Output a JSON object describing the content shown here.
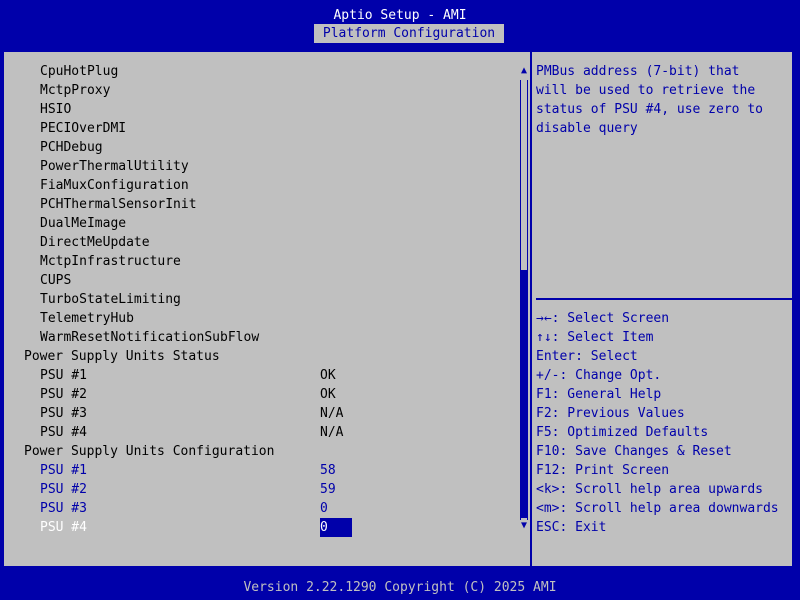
{
  "header": {
    "title": "Aptio Setup - AMI",
    "tab": "Platform Configuration"
  },
  "left": {
    "items": [
      "CpuHotPlug",
      "MctpProxy",
      "HSIO",
      "PECIOverDMI",
      "PCHDebug",
      "PowerThermalUtility",
      "FiaMuxConfiguration",
      "PCHThermalSensorInit",
      "DualMeImage",
      "DirectMeUpdate",
      "MctpInfrastructure",
      "CUPS",
      "TurboStateLimiting",
      "TelemetryHub",
      "WarmResetNotificationSubFlow"
    ],
    "status_heading": "Power Supply Units Status",
    "status_rows": [
      {
        "label": "PSU #1",
        "value": "OK"
      },
      {
        "label": "PSU #2",
        "value": "OK"
      },
      {
        "label": "PSU #3",
        "value": "N/A"
      },
      {
        "label": "PSU #4",
        "value": "N/A"
      }
    ],
    "config_heading": "Power Supply Units Configuration",
    "config_rows": [
      {
        "label": "PSU #1",
        "value": "58"
      },
      {
        "label": "PSU #2",
        "value": "59"
      },
      {
        "label": "PSU #3",
        "value": "0"
      },
      {
        "label": "PSU #4",
        "value": "0",
        "focused": true
      }
    ]
  },
  "help": {
    "description": [
      "PMBus address (7-bit) that",
      "will be used to retrieve the",
      "status of PSU #4, use zero to",
      "disable query"
    ],
    "keys": [
      "→←: Select Screen",
      "↑↓: Select Item",
      "Enter: Select",
      "+/-: Change Opt.",
      "F1: General Help",
      "F2: Previous Values",
      "F5: Optimized Defaults",
      "F10: Save Changes & Reset",
      "F12: Print Screen",
      "<k>: Scroll help area upwards",
      "<m>: Scroll help area downwards",
      "ESC: Exit"
    ]
  },
  "scrollbar": {
    "up_icon": "triangle-up",
    "down_icon": "triangle-down",
    "up_glyph": "▲",
    "down_glyph": "▼"
  },
  "footer": {
    "version": "Version 2.22.1290 Copyright (C) 2025 AMI"
  },
  "colors": {
    "background": "#0000aa",
    "panel": "#c0c0c0",
    "text": "#000000",
    "selectable": "#0000aa",
    "highlight": "#ffffff"
  }
}
